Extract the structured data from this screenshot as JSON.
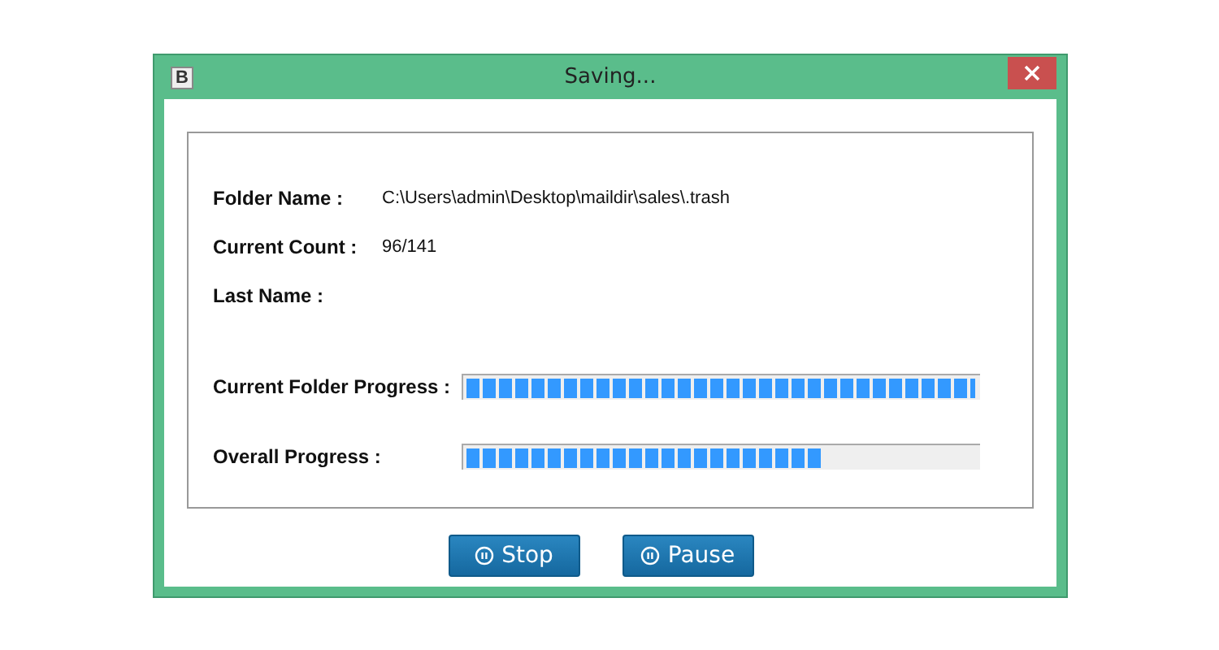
{
  "window": {
    "title": "Saving...",
    "app_icon": "B"
  },
  "fields": [
    {
      "label": "Folder Name :",
      "value": "C:\\Users\\admin\\Desktop\\maildir\\sales\\.trash"
    },
    {
      "label": "Current Count :",
      "value": "96/141"
    },
    {
      "label": "Last Name :"
    }
  ],
  "progress": [
    {
      "label": "Current Folder Progress :",
      "level": 0.99
    },
    {
      "label": "Overall Progress :",
      "level": 0.69
    }
  ],
  "buttons": [
    "Stop",
    "Pause"
  ]
}
